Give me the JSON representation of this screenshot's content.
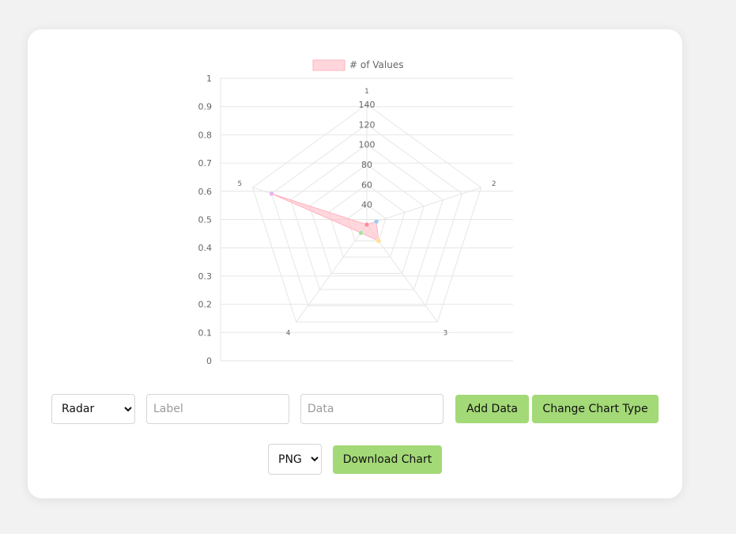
{
  "chart_data": {
    "type": "radar",
    "legend": {
      "label": "# of Values",
      "position": "top",
      "fill": "#ffd6dc",
      "stroke": "#ffb3bf"
    },
    "labels": [
      "1",
      "2",
      "3",
      "4",
      "5"
    ],
    "series": [
      {
        "name": "# of Values",
        "values": [
          20,
          30,
          40,
          30,
          120
        ]
      }
    ],
    "point_colors": [
      "#ff8a9e",
      "#9ec8f2",
      "#ffe08a",
      "#a6e3a1",
      "#e7b3f0"
    ],
    "r_scale": {
      "min": 20,
      "max": 140,
      "ticks": [
        40,
        60,
        80,
        100,
        120,
        140
      ]
    },
    "y_scale": {
      "min": 0,
      "max": 1,
      "ticks": [
        "0",
        "0.1",
        "0.2",
        "0.3",
        "0.4",
        "0.5",
        "0.6",
        "0.7",
        "0.8",
        "0.9",
        "1"
      ]
    },
    "grid": true
  },
  "controls": {
    "chart_type": {
      "selected": "Radar",
      "options": [
        "Radar"
      ]
    },
    "label_input": {
      "placeholder": "Label"
    },
    "data_input": {
      "placeholder": "Data"
    },
    "add_button": "Add Data",
    "change_type_button": "Change Chart Type",
    "format": {
      "selected": "PNG",
      "options": [
        "PNG"
      ]
    },
    "download_button": "Download Chart"
  }
}
